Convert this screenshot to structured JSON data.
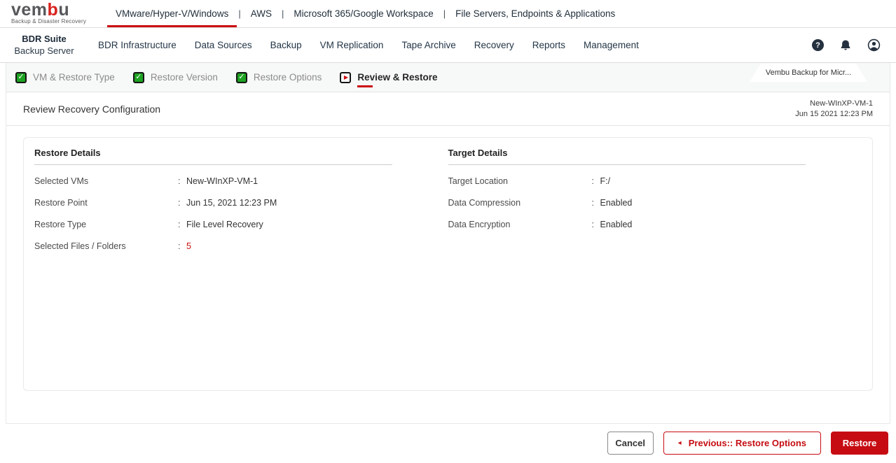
{
  "brand": {
    "logo_part1": "vem",
    "logo_part2": "b",
    "logo_part3": "u",
    "tagline": "Backup & Disaster Recovery"
  },
  "top_nav": {
    "separator": "|",
    "items": [
      {
        "label": "VMware/Hyper-V/Windows",
        "active": true
      },
      {
        "label": "AWS",
        "active": false
      },
      {
        "label": "Microsoft 365/Google Workspace",
        "active": false
      },
      {
        "label": "File Servers, Endpoints & Applications",
        "active": false
      }
    ]
  },
  "main_nav": {
    "suite_title": "BDR Suite",
    "suite_subtitle": "Backup Server",
    "items": [
      "BDR Infrastructure",
      "Data Sources",
      "Backup",
      "VM Replication",
      "Tape Archive",
      "Recovery",
      "Reports",
      "Management"
    ]
  },
  "icons": {
    "check": "✓",
    "play": "▶",
    "help": "?",
    "previous_arrow": "◂"
  },
  "wizard": {
    "tab_label": "Vembu Backup for Micr...",
    "steps": [
      {
        "label": "VM & Restore Type",
        "state": "completed"
      },
      {
        "label": "Restore Version",
        "state": "completed"
      },
      {
        "label": "Restore Options",
        "state": "completed"
      },
      {
        "label": "Review & Restore",
        "state": "active"
      }
    ]
  },
  "page": {
    "title": "Review Recovery Configuration",
    "context_vm": "New-WInXP-VM-1",
    "context_time": "Jun 15 2021 12:23 PM"
  },
  "restore_details": {
    "title": "Restore Details",
    "colon": ":",
    "rows": [
      {
        "label": "Selected VMs",
        "value": "New-WInXP-VM-1"
      },
      {
        "label": "Restore Point",
        "value": "Jun 15, 2021 12:23 PM"
      },
      {
        "label": "Restore Type",
        "value": "File Level Recovery"
      },
      {
        "label": "Selected Files / Folders",
        "value": "5"
      }
    ]
  },
  "target_details": {
    "title": "Target Details",
    "colon": ":",
    "rows": [
      {
        "label": "Target Location",
        "value": "F:/"
      },
      {
        "label": "Data Compression",
        "value": "Enabled"
      },
      {
        "label": "Data Encryption",
        "value": "Enabled"
      }
    ]
  },
  "footer": {
    "cancel_label": "Cancel",
    "previous_label": "Previous:: Restore Options",
    "restore_label": "Restore"
  },
  "colors": {
    "accent_red": "#c60c12",
    "check_green": "#1da321",
    "link_red": "#cb1111",
    "nav_dark": "#24313e"
  }
}
